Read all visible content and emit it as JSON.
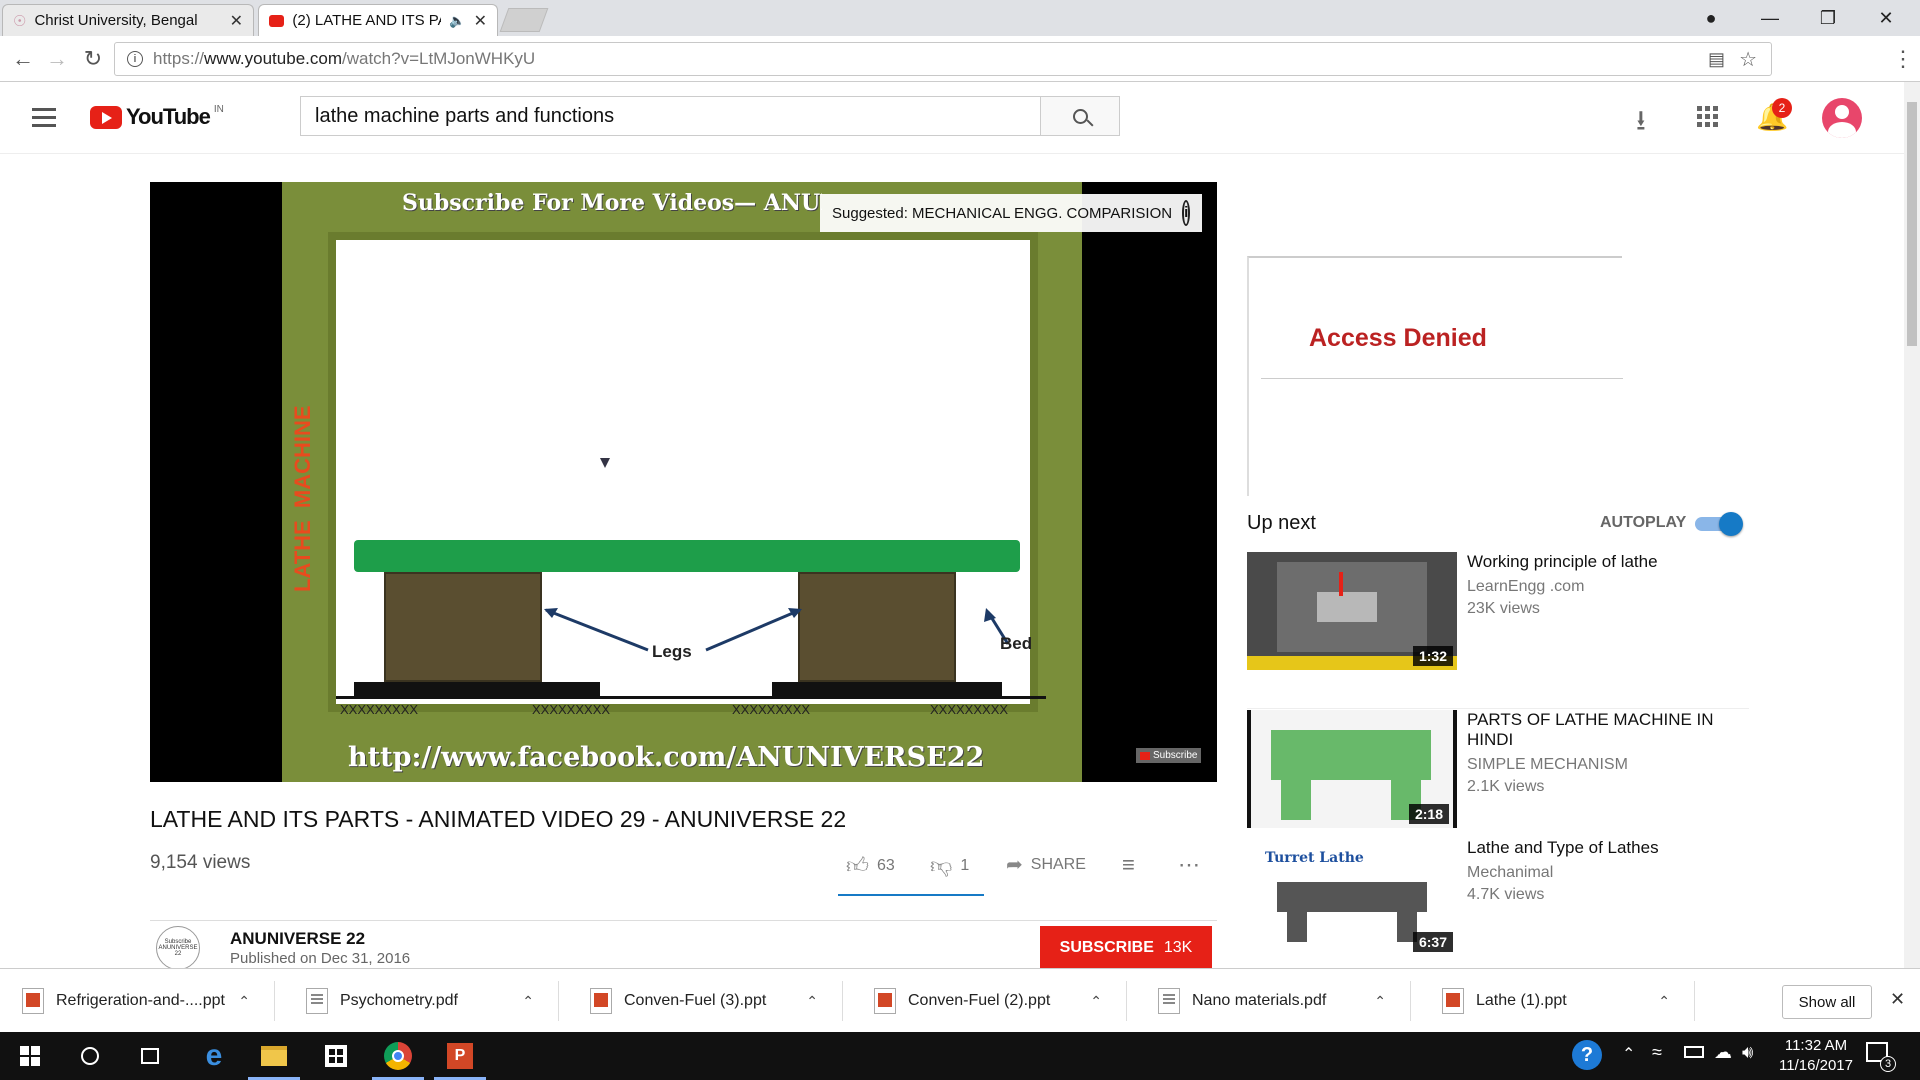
{
  "browser": {
    "tabs": [
      {
        "title": "Christ University, Bengal",
        "active": false
      },
      {
        "title": "(2) LATHE AND ITS PA",
        "active": true
      }
    ],
    "url_prefix": "https://",
    "url_host": "www.youtube.com",
    "url_path": "/watch?v=LtMJonWHKyU"
  },
  "youtube": {
    "logo_text": "YouTube",
    "region": "IN",
    "search_value": "lathe machine parts and functions",
    "notifications_count": "2"
  },
  "video": {
    "banner_top": "Subscribe For More Videos— ANUNIVERSE 22",
    "banner_bottom": "http://www.facebook.com/ANUNIVERSE22",
    "side_label": "LATHE  MACHINE",
    "label_legs": "Legs",
    "label_bed": "Bed",
    "x_marks": [
      "XXXXXXXXX",
      "XXXXXXXXX",
      "XXXXXXXXX",
      "XXXXXXXXX"
    ],
    "suggested": "Suggested: MECHANICAL ENGG. COMPARISION",
    "subscribe_watermark": "Subscribe",
    "title": "LATHE AND ITS PARTS - ANIMATED VIDEO 29 - ANUNIVERSE 22",
    "views": "9,154 views",
    "likes": "63",
    "dislikes": "1",
    "share_label": "SHARE"
  },
  "channel": {
    "name": "ANUNIVERSE 22",
    "published": "Published on Dec 31, 2016",
    "avatar_text": "Subscribe ANUNIVERSE 22",
    "subscribe_label": "SUBSCRIBE",
    "subscriber_count": "13K"
  },
  "sidebar": {
    "ad_message": "Access Denied",
    "up_next_label": "Up next",
    "autoplay_label": "AUTOPLAY",
    "autoplay_on": true,
    "recommendations": [
      {
        "title": "Working principle of lathe",
        "channel": "LearnEngg .com",
        "views": "23K views",
        "duration": "1:32"
      },
      {
        "title": "PARTS OF LATHE MACHINE IN HINDI",
        "channel": "SIMPLE MECHANISM",
        "views": "2.1K views",
        "duration": "2:18"
      },
      {
        "title": "Lathe and Type of Lathes",
        "channel": "Mechanimal",
        "views": "4.7K views",
        "duration": "6:37",
        "thumb_label": "Turret Lathe"
      }
    ]
  },
  "downloads": {
    "items": [
      {
        "name": "Refrigeration-and-....ppt",
        "type": "ppt"
      },
      {
        "name": "Psychometry.pdf",
        "type": "pdf"
      },
      {
        "name": "Conven-Fuel (3).ppt",
        "type": "ppt"
      },
      {
        "name": "Conven-Fuel (2).ppt",
        "type": "ppt"
      },
      {
        "name": "Nano materials.pdf",
        "type": "pdf"
      },
      {
        "name": "Lathe (1).ppt",
        "type": "ppt"
      }
    ],
    "show_all_label": "Show all"
  },
  "taskbar": {
    "time": "11:32 AM",
    "date": "11/16/2017",
    "notification_count": "3"
  }
}
